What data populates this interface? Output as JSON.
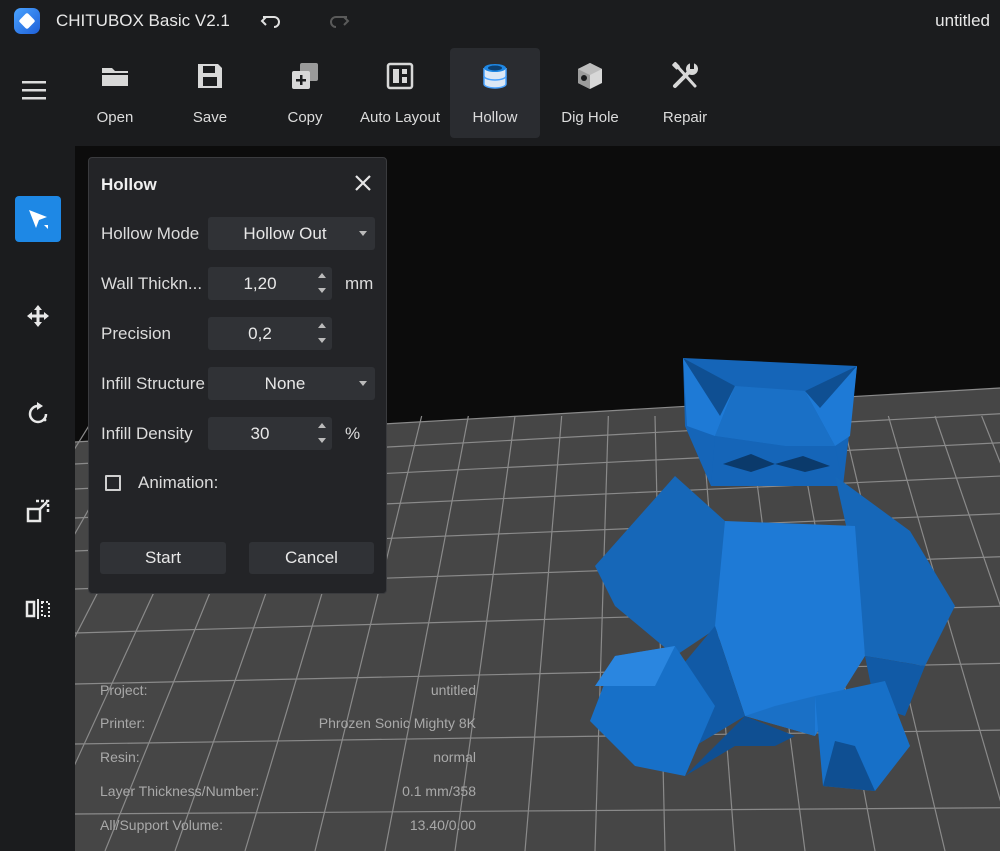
{
  "app": {
    "title": "CHITUBOX Basic V2.1",
    "file_name": "untitled"
  },
  "toolbar": {
    "items": [
      {
        "label": "Open",
        "icon": "folder-icon"
      },
      {
        "label": "Save",
        "icon": "floppy-icon"
      },
      {
        "label": "Copy",
        "icon": "copy-icon"
      },
      {
        "label": "Auto Layout",
        "icon": "layout-icon"
      },
      {
        "label": "Hollow",
        "icon": "hollow-cylinder-icon",
        "active": true
      },
      {
        "label": "Dig Hole",
        "icon": "cube-hole-icon"
      },
      {
        "label": "Repair",
        "icon": "wrench-screwdriver-icon"
      }
    ]
  },
  "sidebar": {
    "items": [
      {
        "icon": "select-arrow-icon",
        "active": true
      },
      {
        "icon": "move-icon"
      },
      {
        "icon": "rotate-icon"
      },
      {
        "icon": "scale-icon"
      },
      {
        "icon": "mirror-icon"
      }
    ]
  },
  "hollow_panel": {
    "title": "Hollow",
    "hollow_mode": {
      "label": "Hollow Mode",
      "value": "Hollow Out"
    },
    "wall_thickness": {
      "label": "Wall Thickn...",
      "value": "1,20",
      "unit": "mm"
    },
    "precision": {
      "label": "Precision",
      "value": "0,2"
    },
    "infill_structure": {
      "label": "Infill Structure",
      "value": "None"
    },
    "infill_density": {
      "label": "Infill Density",
      "value": "30",
      "unit": "%"
    },
    "animation": {
      "label": "Animation:",
      "checked": false
    },
    "start_label": "Start",
    "cancel_label": "Cancel"
  },
  "info": {
    "rows": [
      {
        "key": "Project:",
        "value": "untitled"
      },
      {
        "key": "Printer:",
        "value": "Phrozen Sonic Mighty 8K"
      },
      {
        "key": "Resin:",
        "value": "normal"
      },
      {
        "key": "Layer Thickness/Number:",
        "value": "0.1 mm/358"
      },
      {
        "key": "All/Support Volume:",
        "value": "13.40/0.00"
      }
    ]
  },
  "colors": {
    "accent": "#1e88e5",
    "model": "#1a73c9",
    "platform": "#4a4a4a",
    "background": "#0c0c0c"
  }
}
